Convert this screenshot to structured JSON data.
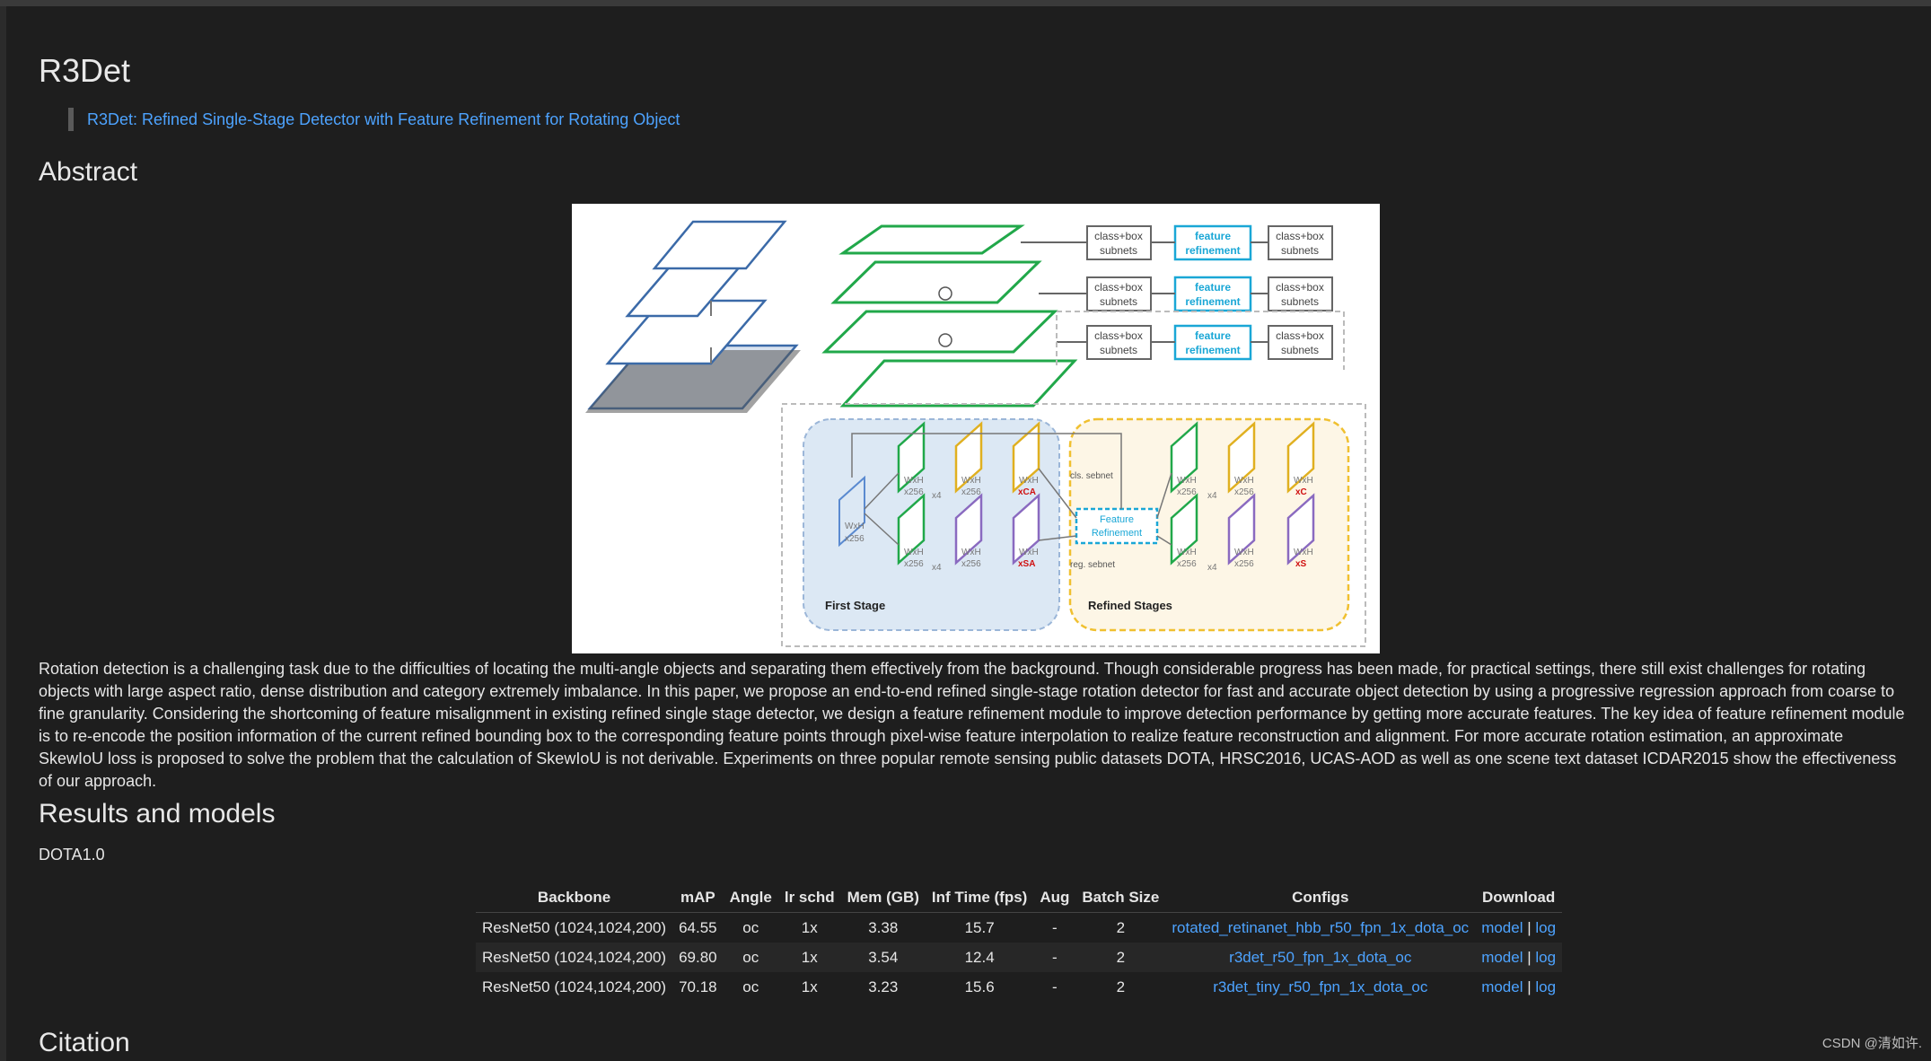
{
  "title": "R3Det",
  "paper_link": "R3Det: Refined Single-Stage Detector with Feature Refinement for Rotating Object",
  "abstract_heading": "Abstract",
  "figure": {
    "box_label": "class+box\nsubnets",
    "feature_refinement": "feature\nrefinement",
    "wxh": "WxH",
    "x256": "x256",
    "x4": "x4",
    "xCA": "xCA",
    "xSA": "xSA",
    "xC": "xC",
    "xS": "xS",
    "cls_sebnet": "cls. sebnet",
    "reg_sebnet": "reg. sebnet",
    "feature_refinement_box": "Feature\nRefinement",
    "first_stage": "First Stage",
    "refined_stages": "Refined Stages"
  },
  "abstract_text": "Rotation detection is a challenging task due to the difficulties of locating the multi-angle objects and separating them effectively from the background. Though considerable progress has been made, for practical settings, there still exist challenges for rotating objects with large aspect ratio, dense distribution and category extremely imbalance. In this paper, we propose an end-to-end refined single-stage rotation detector for fast and accurate object detection by using a progressive regression approach from coarse to fine granularity. Considering the shortcoming of feature misalignment in existing refined single stage detector, we design a feature refinement module to improve detection performance by getting more accurate features. The key idea of feature refinement module is to re-encode the position information of the current refined bounding box to the corresponding feature points through pixel-wise feature interpolation to realize feature reconstruction and alignment. For more accurate rotation estimation, an approximate SkewIoU loss is proposed to solve the problem that the calculation of SkewIoU is not derivable. Experiments on three popular remote sensing public datasets DOTA, HRSC2016, UCAS-AOD as well as one scene text dataset ICDAR2015 show the effectiveness of our approach.",
  "results_heading": "Results and models",
  "dataset": "DOTA1.0",
  "table": {
    "headers": [
      "Backbone",
      "mAP",
      "Angle",
      "lr schd",
      "Mem (GB)",
      "Inf Time (fps)",
      "Aug",
      "Batch Size",
      "Configs",
      "Download"
    ],
    "rows": [
      [
        "ResNet50 (1024,1024,200)",
        "64.55",
        "oc",
        "1x",
        "3.38",
        "15.7",
        "-",
        "2",
        "rotated_retinanet_hbb_r50_fpn_1x_dota_oc"
      ],
      [
        "ResNet50 (1024,1024,200)",
        "69.80",
        "oc",
        "1x",
        "3.54",
        "12.4",
        "-",
        "2",
        "r3det_r50_fpn_1x_dota_oc"
      ],
      [
        "ResNet50 (1024,1024,200)",
        "70.18",
        "oc",
        "1x",
        "3.23",
        "15.6",
        "-",
        "2",
        "r3det_tiny_r50_fpn_1x_dota_oc"
      ]
    ],
    "model_label": "model",
    "sep": "|",
    "log_label": "log"
  },
  "citation_heading": "Citation",
  "watermark": "CSDN @清如许."
}
